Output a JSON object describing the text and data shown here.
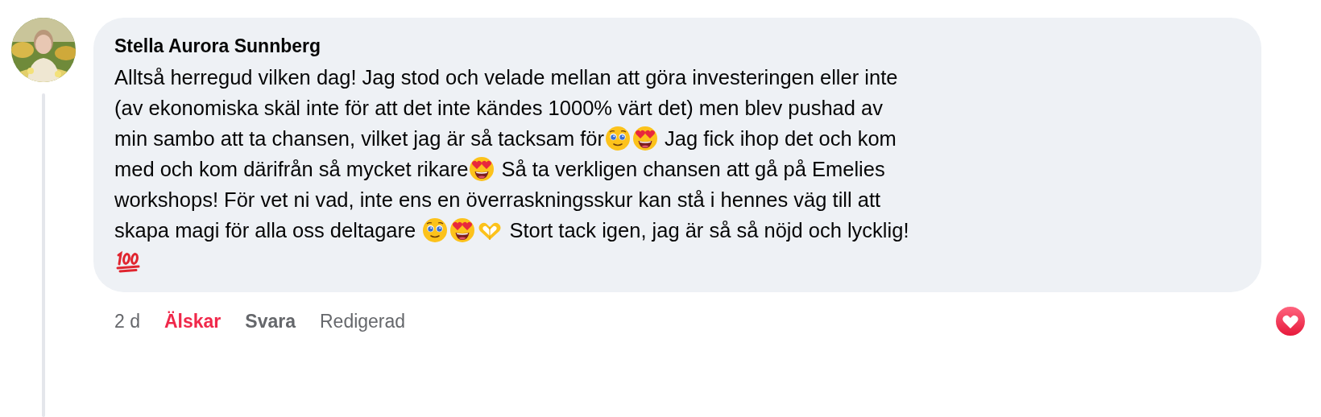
{
  "comment": {
    "author": "Stella Aurora Sunnberg",
    "lines": [
      [
        {
          "kind": "text",
          "text": "Alltså herregud vilken dag! Jag stod och velade mellan att göra investeringen eller inte"
        }
      ],
      [
        {
          "kind": "text",
          "text": "(av ekonomiska skäl inte för att det inte kändes 1000% värt det) men blev pushad av"
        }
      ],
      [
        {
          "kind": "text",
          "text": "min sambo att ta chansen, vilket jag är så tacksam för"
        },
        {
          "kind": "teary-face"
        },
        {
          "kind": "heart-eyes"
        },
        {
          "kind": "text",
          "text": " Jag fick ihop det och kom"
        }
      ],
      [
        {
          "kind": "text",
          "text": "med och kom därifrån så mycket rikare"
        },
        {
          "kind": "heart-eyes"
        },
        {
          "kind": "text",
          "text": " Så ta verkligen chansen att gå på Emelies"
        }
      ],
      [
        {
          "kind": "text",
          "text": "workshops! För vet ni vad, inte ens en överraskningsskur kan stå i hennes väg till att"
        }
      ],
      [
        {
          "kind": "text",
          "text": "skapa magi för alla oss deltagare "
        },
        {
          "kind": "teary-face"
        },
        {
          "kind": "heart-eyes"
        },
        {
          "kind": "heart-hands"
        },
        {
          "kind": "text",
          "text": " Stort tack igen, jag är så så nöjd och lycklig!"
        }
      ],
      [
        {
          "kind": "hundred"
        }
      ]
    ],
    "time": "2 d",
    "actions": [
      {
        "label": "Älskar",
        "selected": true
      },
      {
        "label": "Svara",
        "selected": false
      }
    ],
    "edited": "Redigerad",
    "reaction": {
      "kind": "love"
    }
  }
}
